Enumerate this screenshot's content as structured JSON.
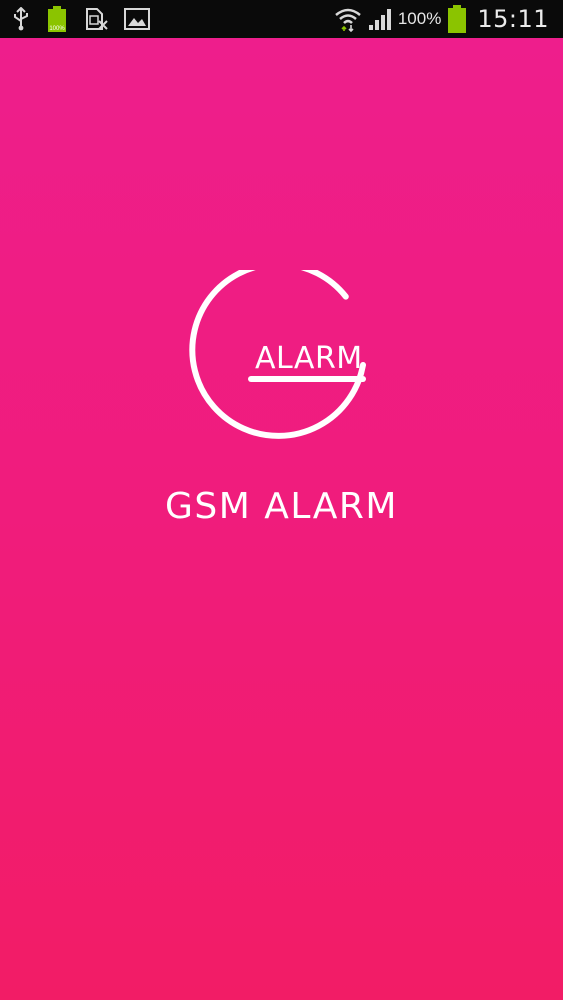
{
  "status_bar": {
    "battery_level_mini": "100%",
    "battery_percent": "100%",
    "time": "15:11",
    "icons": [
      "usb-icon",
      "battery-charging-icon",
      "sim-error-icon",
      "image-icon",
      "wifi-icon",
      "signal-icon",
      "battery-icon"
    ]
  },
  "splash": {
    "logo_text": "ALARM",
    "app_title": "GSM ALARM"
  },
  "colors": {
    "background_top": "#ee1e8c",
    "background_bottom": "#f21c66",
    "foreground": "#ffffff",
    "status_bar": "#0a0a0a",
    "battery_green": "#8bc400"
  }
}
